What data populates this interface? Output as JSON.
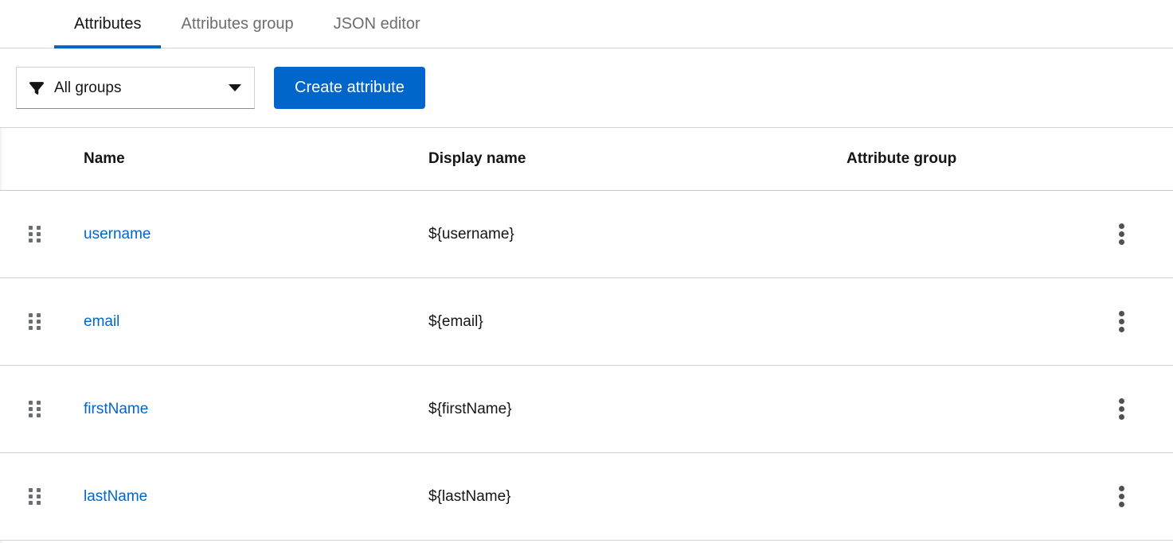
{
  "tabs": {
    "items": [
      {
        "label": "Attributes",
        "active": true
      },
      {
        "label": "Attributes group",
        "active": false
      },
      {
        "label": "JSON editor",
        "active": false
      }
    ]
  },
  "toolbar": {
    "group_filter": {
      "value": "All groups",
      "icon": "filter-icon",
      "caret_icon": "caret-down-icon"
    },
    "create_attribute_label": "Create attribute"
  },
  "table": {
    "columns": {
      "name": "Name",
      "display_name": "Display name",
      "attribute_group": "Attribute group"
    },
    "rows": [
      {
        "name": "username",
        "display_name": "${username}",
        "attribute_group": ""
      },
      {
        "name": "email",
        "display_name": "${email}",
        "attribute_group": ""
      },
      {
        "name": "firstName",
        "display_name": "${firstName}",
        "attribute_group": ""
      },
      {
        "name": "lastName",
        "display_name": "${lastName}",
        "attribute_group": ""
      }
    ]
  },
  "colors": {
    "primary_blue": "#0066cc",
    "link_blue": "#0066cc",
    "text_dark": "#151515",
    "text_gray": "#6a6e73",
    "border_gray": "#d2d2d2"
  }
}
